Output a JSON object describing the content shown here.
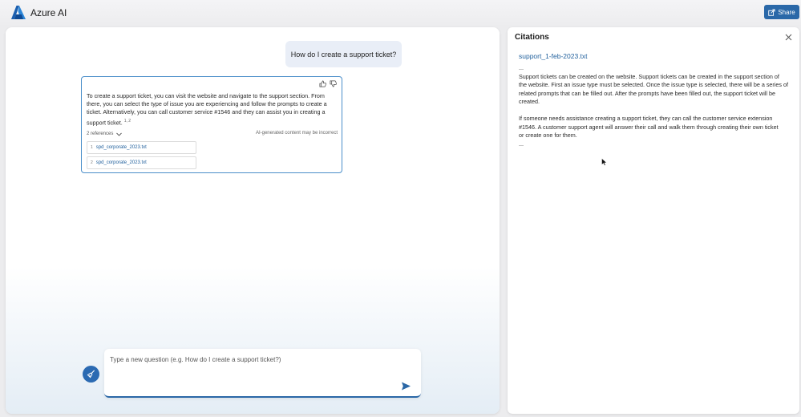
{
  "header": {
    "app_title": "Azure AI",
    "share_label": "Share"
  },
  "chat": {
    "user_question": "How do I create a support ticket?",
    "answer": {
      "text": "To create a support ticket, you can visit the website and navigate to the support section. From there, you can select the type of issue you are experiencing and follow the prompts to create a ticket. Alternatively, you can call customer service #1546 and they can assist you in creating a support ticket.",
      "superscript": "1, 2",
      "references_label": "2 references",
      "disclaimer": "AI-generated content may be incorrect",
      "references": [
        {
          "num": "1",
          "name": "spd_corporate_2023.txt"
        },
        {
          "num": "2",
          "name": "spd_corporate_2023.txt"
        }
      ]
    },
    "input": {
      "placeholder": "Type a new question (e.g. How do I create a support ticket?)",
      "value": ""
    }
  },
  "citations": {
    "title": "Citations",
    "file_name": "support_1-feb-2023.txt",
    "lines": [
      "...",
      "Support tickets can be created on the website. Support tickets can be created in the support section of",
      "the website. First an issue type must be selected. Once the issue type is selected, there will be a series of",
      "related prompts that can be filled out. After the prompts have been filled out, the support ticket will be",
      "created.",
      "",
      "If someone needs assistance creating a support ticket, they can call the customer service extension",
      "#1546. A customer support agent will answer their call and walk them through creating their own ticket",
      "or create one for them.",
      "..."
    ]
  },
  "icons": {
    "logo": "azure-logo-icon",
    "share": "share-icon",
    "thumbs_up": "thumbs-up-icon",
    "thumbs_down": "thumbs-down-icon",
    "chevron": "chevron-down-icon",
    "broom": "broom-icon",
    "send": "send-icon",
    "close": "close-icon"
  },
  "colors": {
    "accent": "#2a68a8",
    "link": "#1f5f9c",
    "card_border": "#4a8ec9",
    "user_bubble": "#e9eef7"
  }
}
